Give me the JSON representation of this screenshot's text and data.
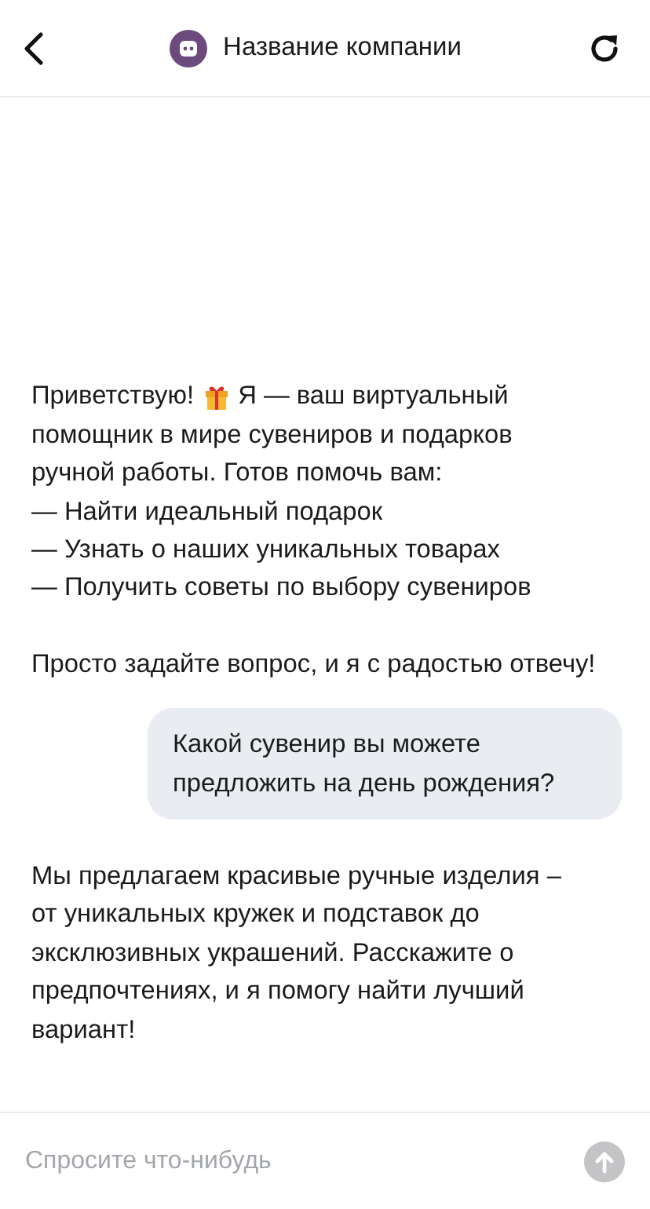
{
  "header": {
    "title": "Название компании"
  },
  "greeting": {
    "lead": "Приветствую!",
    "lines": [
      "Я — ваш виртуальный",
      "помощник в мире сувениров и подарков",
      "ручной работы. Готов помочь вам:"
    ],
    "items": [
      "— Найти идеальный подарок",
      "— Узнать о наших уникальных товарах",
      "— Получить советы по выбору сувениров"
    ],
    "closing": "Просто задайте вопрос, и я с радостью отвечу!"
  },
  "messages": [
    {
      "kind": "user",
      "text": "Какой сувенир вы можете предложить на день рождения?"
    },
    {
      "kind": "bot",
      "text": "Мы предлагаем красивые ручные изделия – от уникальных кружек и подставок до эксклюзивных украшений. Расскажите о предпочтениях, и я помогу найти лучший вариант!"
    }
  ],
  "composer": {
    "placeholder": "Спросите что-нибудь"
  }
}
